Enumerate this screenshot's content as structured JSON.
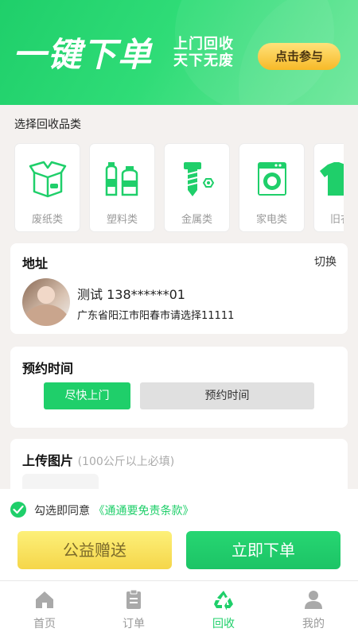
{
  "banner": {
    "title": "一键下单",
    "subtitle_line1": "上门回收",
    "subtitle_line2": "天下无废",
    "cta": "点击参与"
  },
  "category_section": {
    "title": "选择回收品类",
    "items": [
      {
        "label": "废纸类",
        "icon": "box-icon"
      },
      {
        "label": "塑料类",
        "icon": "bottles-icon"
      },
      {
        "label": "金属类",
        "icon": "screw-nut-icon"
      },
      {
        "label": "家电类",
        "icon": "washing-machine-icon"
      },
      {
        "label": "旧衣",
        "icon": "shirt-icon"
      }
    ]
  },
  "address": {
    "heading": "地址",
    "switch_label": "切换",
    "name_phone": "测试 138******01",
    "detail": "广东省阳江市阳春市请选择11111"
  },
  "appointment": {
    "heading": "预约时间",
    "option_asap": "尽快上门",
    "option_schedule": "预约时间"
  },
  "upload": {
    "heading": "上传图片",
    "hint": "(100公斤以上必填)"
  },
  "agreement": {
    "text": "勾选即同意",
    "link": "《通通要免责条款》",
    "checked": true
  },
  "actions": {
    "donate": "公益赠送",
    "order_now": "立即下单"
  },
  "tabbar": {
    "items": [
      {
        "label": "首页",
        "icon": "home-icon"
      },
      {
        "label": "订单",
        "icon": "clipboard-icon"
      },
      {
        "label": "回收",
        "icon": "recycle-icon"
      },
      {
        "label": "我的",
        "icon": "user-icon"
      }
    ],
    "active_index": 2
  },
  "colors": {
    "primary_green": "#1fcf6a",
    "yellow": "#f5d64a",
    "inactive_gray": "#999999"
  }
}
